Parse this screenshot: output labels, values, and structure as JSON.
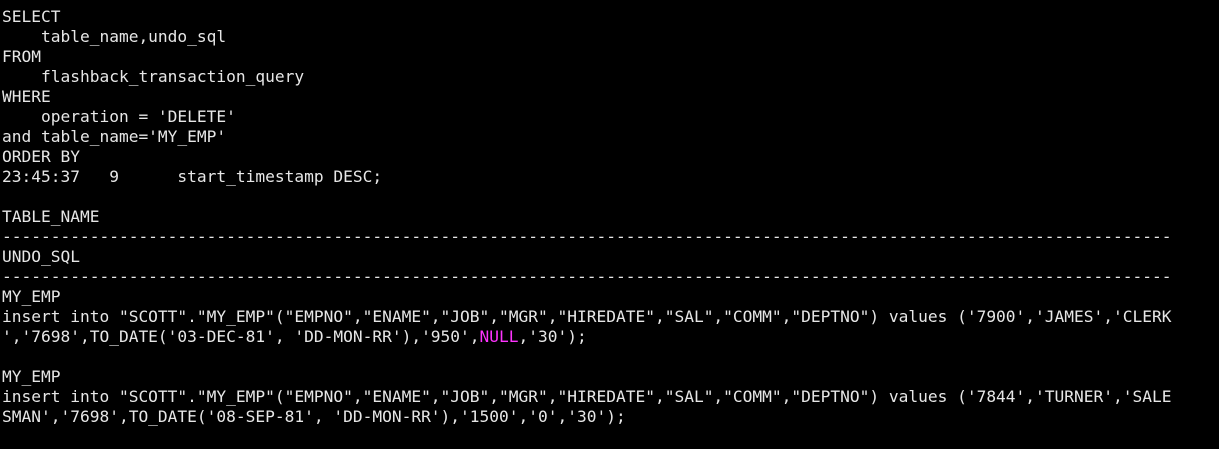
{
  "terminal": {
    "background": "#000000",
    "foreground": "#e6e6e6",
    "null_color": "#ff33ff",
    "lines": [
      "SELECT",
      "    table_name,undo_sql",
      "FROM",
      "    flashback_transaction_query",
      "WHERE",
      "    operation = 'DELETE'",
      "and table_name='MY_EMP'",
      "ORDER BY",
      "23:45:37   9      start_timestamp DESC;",
      "",
      "TABLE_NAME",
      "------------------------------------------------------------------------------------------------------------------------",
      "UNDO_SQL",
      "------------------------------------------------------------------------------------------------------------------------",
      "MY_EMP",
      "insert into \"SCOTT\".\"MY_EMP\"(\"EMPNO\",\"ENAME\",\"JOB\",\"MGR\",\"HIREDATE\",\"SAL\",\"COMM\",\"DEPTNO\") values ('7900','JAMES','CLERK",
      {
        "before": "','7698',TO_DATE('03-DEC-81', 'DD-MON-RR'),'950',",
        "null": "NULL",
        "after": ",'30');"
      },
      "",
      "MY_EMP",
      "insert into \"SCOTT\".\"MY_EMP\"(\"EMPNO\",\"ENAME\",\"JOB\",\"MGR\",\"HIREDATE\",\"SAL\",\"COMM\",\"DEPTNO\") values ('7844','TURNER','SALE",
      "SMAN','7698',TO_DATE('08-SEP-81', 'DD-MON-RR'),'1500','0','30');"
    ]
  }
}
